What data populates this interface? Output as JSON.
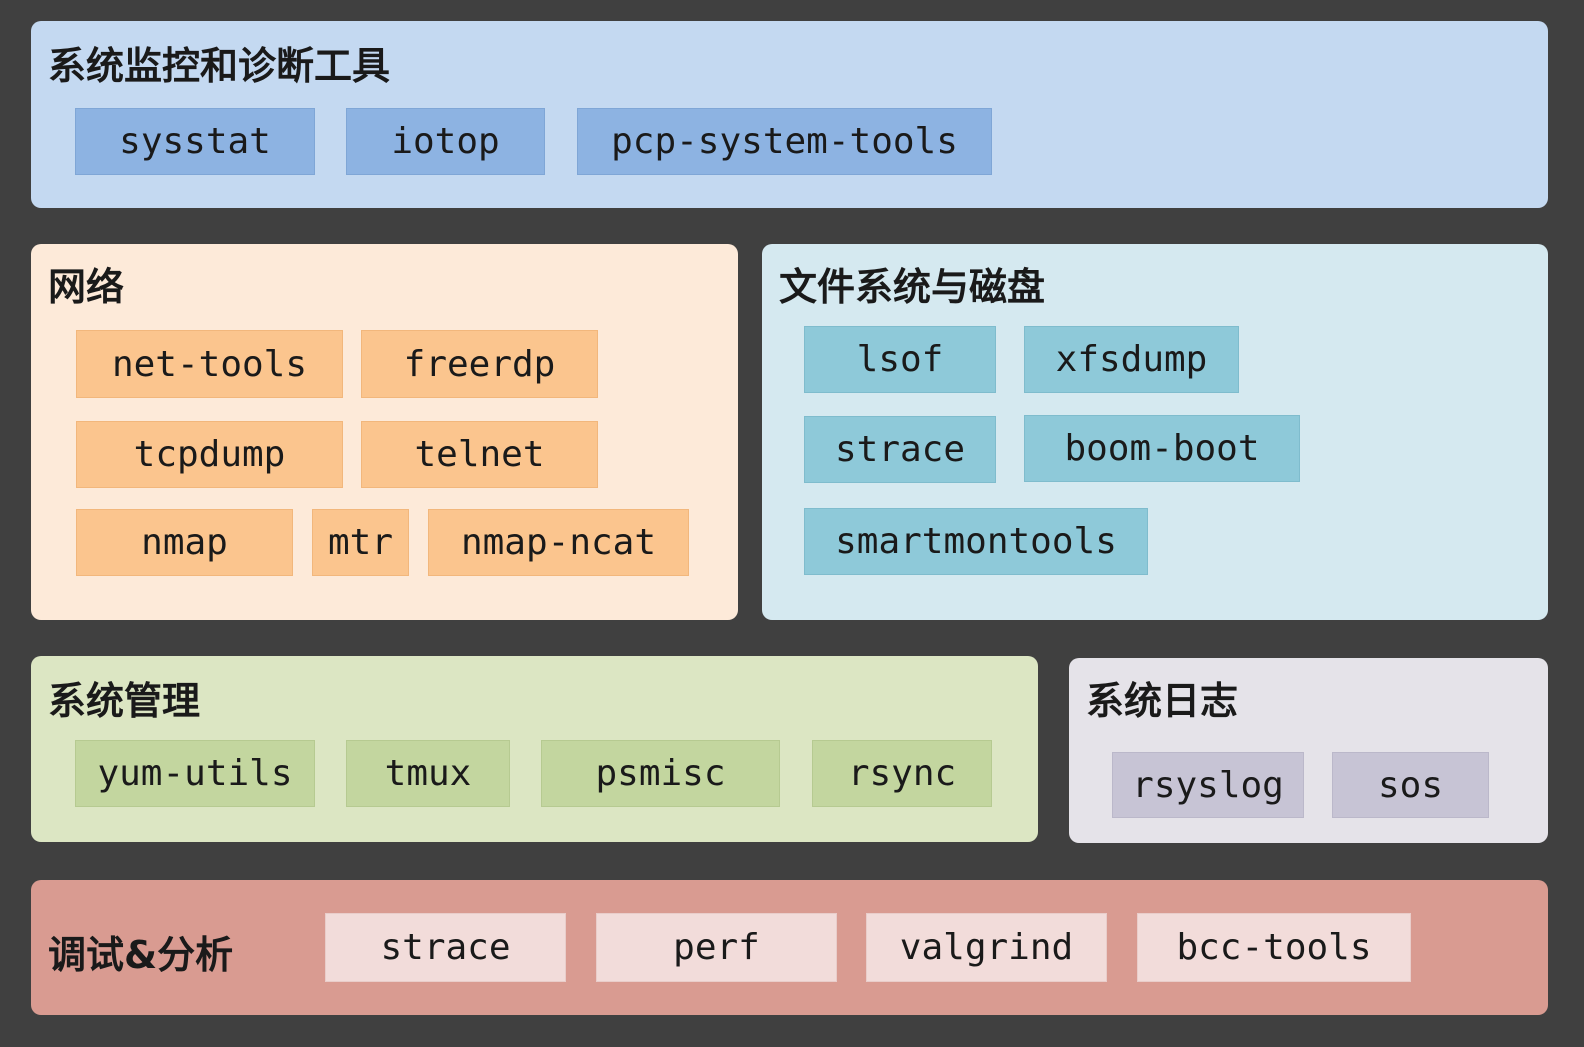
{
  "sections": {
    "monitoring": {
      "title": "系统监控和诊断工具",
      "tags": [
        "sysstat",
        "iotop",
        "pcp-system-tools"
      ]
    },
    "network": {
      "title": "网络",
      "tags": [
        "net-tools",
        "freerdp",
        "tcpdump",
        "telnet",
        "nmap",
        "mtr",
        "nmap-ncat"
      ]
    },
    "filesystem": {
      "title": "文件系统与磁盘",
      "tags": [
        "lsof",
        "xfsdump",
        "strace",
        "boom-boot",
        "smartmontools"
      ]
    },
    "sysadmin": {
      "title": "系统管理",
      "tags": [
        "yum-utils",
        "tmux",
        "psmisc",
        "rsync"
      ]
    },
    "logging": {
      "title": "系统日志",
      "tags": [
        "rsyslog",
        "sos"
      ]
    },
    "debugging": {
      "title": "调试&分析",
      "tags": [
        "strace",
        "perf",
        "valgrind",
        "bcc-tools"
      ]
    }
  },
  "colors": {
    "background": "#404040",
    "monitoring": "#c4d9f1",
    "monitoring_tag": "#8db3e2",
    "network": "#fdead9",
    "network_tag": "#fbc58e",
    "filesystem": "#d5e9f0",
    "filesystem_tag": "#8ec9d9",
    "sysadmin": "#dce6c3",
    "sysadmin_tag": "#c3d69f",
    "logging": "#e5e3e9",
    "logging_tag": "#c7c4d5",
    "debugging": "#d99b91",
    "debugging_tag": "#f2dcda"
  }
}
